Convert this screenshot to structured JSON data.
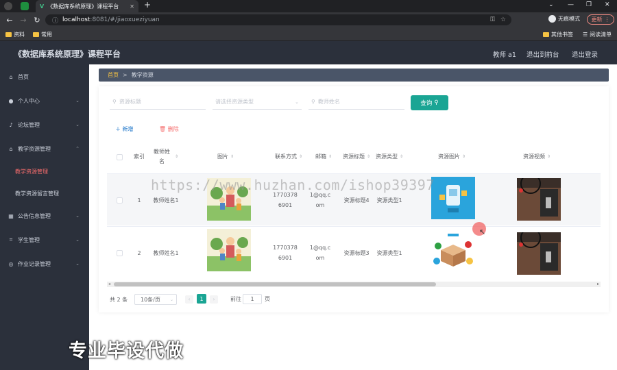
{
  "browser": {
    "tab_title": "《数据库系统原理》课程平台",
    "new_tab": "+",
    "url_host": "localhost",
    "url_path": ":8081/#/jiaoxueziyuan",
    "incognito_label": "无痕模式",
    "update_label": "更新",
    "bookmarks": [
      "资料",
      "常用"
    ],
    "bookmarks_right": [
      "其他书签",
      "阅读清单"
    ]
  },
  "app": {
    "title": "《数据库系统原理》课程平台",
    "user": "教师 a1",
    "to_front": "退出到前台",
    "logout": "退出登录"
  },
  "sidebar": {
    "items": [
      {
        "label": "首页",
        "icon": "home-icon"
      },
      {
        "label": "个人中心",
        "icon": "user-icon"
      },
      {
        "label": "论坛管理",
        "icon": "mic-icon"
      },
      {
        "label": "教学资源管理",
        "icon": "bank-icon"
      },
      {
        "label": "教学资源管理",
        "sub": true,
        "active": true
      },
      {
        "label": "教学资源留言管理",
        "sub": true
      },
      {
        "label": "公告信息管理",
        "icon": "grid-icon"
      },
      {
        "label": "学生管理",
        "icon": "crop-icon"
      },
      {
        "label": "作业记录管理",
        "icon": "compass-icon"
      }
    ]
  },
  "breadcrumb": {
    "home": "首页",
    "sep": ">",
    "current": "教学资源"
  },
  "search": {
    "title_placeholder": "资源标题",
    "type_placeholder": "请选择资源类型",
    "teacher_placeholder": "教师姓名",
    "query_label": "查询"
  },
  "actions": {
    "add": "新增",
    "delete": "删除"
  },
  "table": {
    "headers": [
      "索引",
      "教师姓名",
      "图片",
      "联系方式",
      "邮箱",
      "资源标题",
      "资源类型",
      "资源图片",
      "资源视频"
    ],
    "rows": [
      {
        "index": "1",
        "teacher": "教师姓名1",
        "phone": "17703786901",
        "email": "1@qq.com",
        "title": "资源标题4",
        "type": "资源类型1"
      },
      {
        "index": "2",
        "teacher": "教师姓名1",
        "phone": "17703786901",
        "email": "1@qq.com",
        "title": "资源标题3",
        "type": "资源类型1"
      }
    ]
  },
  "pagination": {
    "total": "共 2 条",
    "page_size": "10条/页",
    "current_page": "1",
    "goto": "前往",
    "goto_value": "1",
    "goto_suffix": "页"
  },
  "watermark": "https://www.huzhan.com/ishop39397",
  "overlay_caption": "专业毕设代做",
  "colors": {
    "accent": "#1aa594",
    "sidebar": "#2b303b",
    "danger": "#f56c6c",
    "link": "#1a73c8"
  }
}
